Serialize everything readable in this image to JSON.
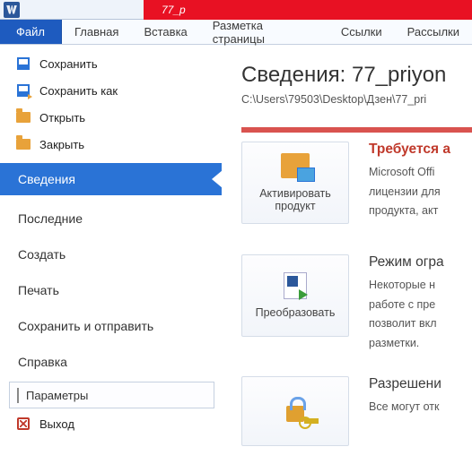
{
  "titlebar": {
    "doc_tab": "77_p"
  },
  "ribbon": {
    "file": "Файл",
    "tabs": [
      "Главная",
      "Вставка",
      "Разметка страницы",
      "Ссылки",
      "Рассылки"
    ]
  },
  "left": {
    "save": "Сохранить",
    "save_as": "Сохранить как",
    "open": "Открыть",
    "close": "Закрыть",
    "info": "Сведения",
    "recent": "Последние",
    "new": "Создать",
    "print": "Печать",
    "save_send": "Сохранить и отправить",
    "help": "Справка",
    "options": "Параметры",
    "exit": "Выход"
  },
  "info": {
    "title": "Сведения: 77_priyon",
    "path": "C:\\Users\\79503\\Desktop\\Дзен\\77_pri",
    "activate": {
      "button": "Активировать продукт",
      "heading": "Требуется а",
      "line1": "Microsoft Offi",
      "line2": "лицензии для",
      "line3": "продукта, акт"
    },
    "convert": {
      "button": "Преобразовать",
      "heading": "Режим огра",
      "line1": "Некоторые н",
      "line2": "работе с пре",
      "line3": "позволит вкл",
      "line4": "разметки."
    },
    "protect": {
      "heading": "Разрешени",
      "line1": "Все могут отк"
    }
  }
}
